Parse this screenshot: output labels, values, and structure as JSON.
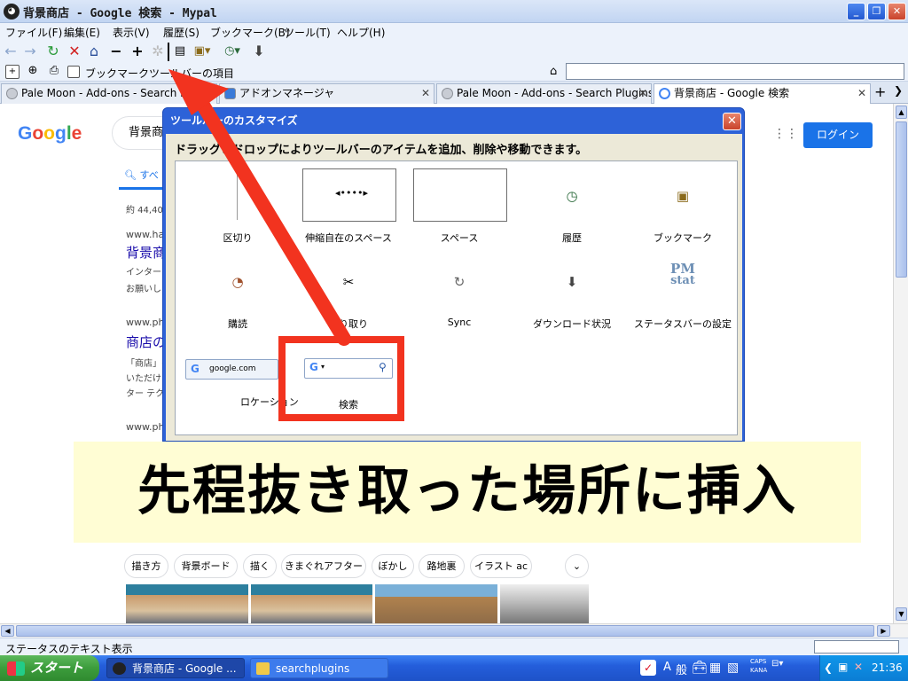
{
  "window": {
    "title": "背景商店 - Google 検索 - Mypal",
    "app_icon": "raccoon-icon",
    "minimize_glyph": "_",
    "maximize_glyph": "❐",
    "close_glyph": "✕"
  },
  "menubar": {
    "items": [
      "ファイル(F)",
      "編集(E)",
      "表示(V)",
      "履歴(S)",
      "ブックマーク(B)",
      "ツール(T)",
      "ヘルプ(H)"
    ]
  },
  "navbar": {
    "icons": [
      "back-icon",
      "forward-icon",
      "reload-icon",
      "stop-icon",
      "home-icon",
      "minus-icon",
      "plus-icon",
      "throbber-icon",
      "copy-icon",
      "bookmark-icon",
      "history-icon",
      "download-icon"
    ]
  },
  "bookmarks_bar": {
    "label": "ブックマークツールバーの項目"
  },
  "tabs": [
    {
      "label": "Pale Moon - Add-ons - Search Plugins",
      "active": false
    },
    {
      "label": "アドオンマネージャ",
      "active": false
    },
    {
      "label": "Pale Moon - Add-ons - Search Plugins",
      "active": false
    },
    {
      "label": "背景商店 - Google 検索",
      "active": true
    }
  ],
  "page": {
    "logo": "Google",
    "search_value": "背景商店",
    "login_label": "ログイン",
    "tab_all": "すべ",
    "result_count": "約 44,40",
    "results": [
      {
        "cite": "www.ha",
        "title": "背景商",
        "lines": [
          "インター",
          "お願いし"
        ]
      },
      {
        "cite": "www.ph",
        "title": "商店の",
        "lines": [
          "「商店」の",
          "いただけ",
          "ター テク"
        ]
      },
      {
        "cite": "www.ph",
        "title": "",
        "lines": []
      }
    ],
    "chips": [
      "描き方",
      "背景ボード",
      "描く",
      "きまぐれアフター",
      "ぼかし",
      "路地裏",
      "イラスト ac"
    ]
  },
  "dialog": {
    "title": "ツールバーのカスタマイズ",
    "header": "ドラッグ＆ドロップによりツールバーのアイテムを追加、削除や移動できます。",
    "items": [
      {
        "label": "区切り",
        "icon": "separator-icon"
      },
      {
        "label": "伸縮自在のスペース",
        "icon": "flexible-space-icon"
      },
      {
        "label": "スペース",
        "icon": "space-icon"
      },
      {
        "label": "履歴",
        "icon": "history-icon"
      },
      {
        "label": "ブックマーク",
        "icon": "bookmark-icon"
      },
      {
        "label": "購読",
        "icon": "rss-icon"
      },
      {
        "label": "切り取り",
        "icon": "scissors-icon"
      },
      {
        "label": "Sync",
        "icon": "sync-icon"
      },
      {
        "label": "ダウンロード状況",
        "icon": "download-icon"
      },
      {
        "label": "ステータスバーの設定",
        "icon": "pmstat-icon"
      },
      {
        "label": "ロケーション",
        "icon": "location-bar"
      },
      {
        "label": "検索",
        "icon": "search-bar"
      }
    ],
    "location_sample": "google.com",
    "pm_label": "PM",
    "stat_label": "stat"
  },
  "overlay": {
    "caption": "先程抜き取った場所に挿入"
  },
  "statusbar": {
    "text": "ステータスのテキスト表示"
  },
  "taskbar": {
    "start_label": "スタート",
    "buttons": [
      {
        "label": "背景商店 - Google ...",
        "active": true
      },
      {
        "label": "searchplugins",
        "active": false
      }
    ],
    "ime_a": "A",
    "ime_kan": "般",
    "caps": "CAPS",
    "kana": "KANA",
    "clock": "21:36"
  },
  "colors": {
    "accent_red": "#f2331f",
    "dialog_blue": "#2d62d8",
    "google_blue": "#1a73e8"
  }
}
